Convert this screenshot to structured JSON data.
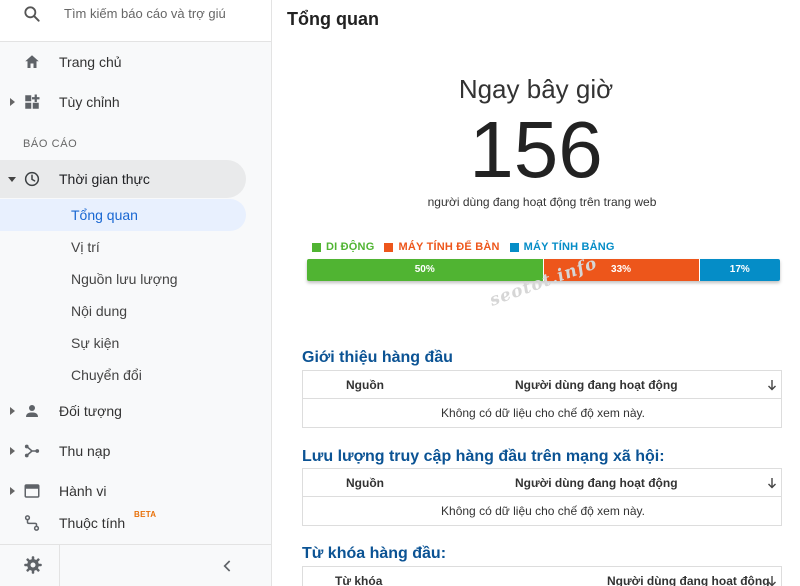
{
  "search": {
    "placeholder": "Tìm kiếm báo cáo và trợ giúp"
  },
  "nav": {
    "home": "Trang chủ",
    "customize": "Tùy chỉnh",
    "reports_label": "BÁO CÁO",
    "realtime": "Thời gian thực",
    "realtime_sub": [
      "Tổng quan",
      "Vị trí",
      "Nguồn lưu lượng",
      "Nội dung",
      "Sự kiện",
      "Chuyển đổi"
    ],
    "audience": "Đối tượng",
    "acquisition": "Thu nạp",
    "behavior": "Hành vi",
    "attributes": "Thuộc tính",
    "beta": "BETA"
  },
  "page": {
    "title": "Tổng quan"
  },
  "realtime": {
    "label": "Ngay bây giờ",
    "count": "156",
    "subtitle": "người dùng đang hoạt động trên trang web"
  },
  "devices": {
    "legend": [
      {
        "name": "DI ĐỘNG",
        "color": "#50b432"
      },
      {
        "name": "MÁY TÍNH ĐỂ BÀN",
        "color": "#ed561b"
      },
      {
        "name": "MÁY TÍNH BẢNG",
        "color": "#058dc7"
      }
    ],
    "segments": [
      {
        "percent": 50,
        "label": "50%",
        "color": "#50b432"
      },
      {
        "percent": 33,
        "label": "33%",
        "color": "#ed561b"
      },
      {
        "percent": 17,
        "label": "17%",
        "color": "#058dc7"
      }
    ]
  },
  "watermark": "seotot.info",
  "tables": [
    {
      "title": "Giới thiệu hàng đầu",
      "col1": "Nguồn",
      "col2": "Người dùng đang hoạt động",
      "empty": "Không có dữ liệu cho chế độ xem này."
    },
    {
      "title": "Lưu lượng truy cập hàng đầu trên mạng xã hội:",
      "col1": "Nguồn",
      "col2": "Người dùng đang hoạt động",
      "empty": "Không có dữ liệu cho chế độ xem này."
    },
    {
      "title": "Từ khóa hàng đầu:",
      "col1": "Từ khóa",
      "col2": "Người dùng đang hoạt động",
      "empty": ""
    }
  ]
}
